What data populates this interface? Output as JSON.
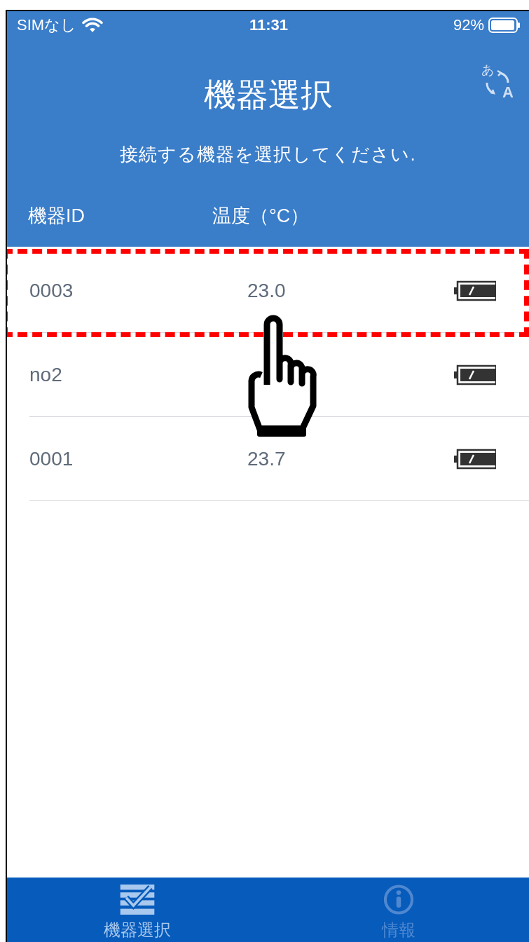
{
  "status_bar": {
    "carrier": "SIMなし",
    "time": "11:31",
    "battery": "92%"
  },
  "header": {
    "title": "機器選択",
    "subtitle": "接続する機器を選択してください.",
    "translate_button": {
      "kana": "あ",
      "latin": "A"
    },
    "columns": [
      "機器ID",
      "温度（°C）"
    ]
  },
  "rows": [
    {
      "id": "0003",
      "temperature": "23.0",
      "highlighted": true
    },
    {
      "id": "no2",
      "highlighted": false
    },
    {
      "id": "0001",
      "temperature": "23.7",
      "highlighted": false
    }
  ],
  "tap_pointer": true,
  "tabs": [
    {
      "label": "機器選択",
      "kind": "checklist",
      "selected": true
    },
    {
      "label": "情報",
      "kind": "info",
      "selected": false
    }
  ]
}
